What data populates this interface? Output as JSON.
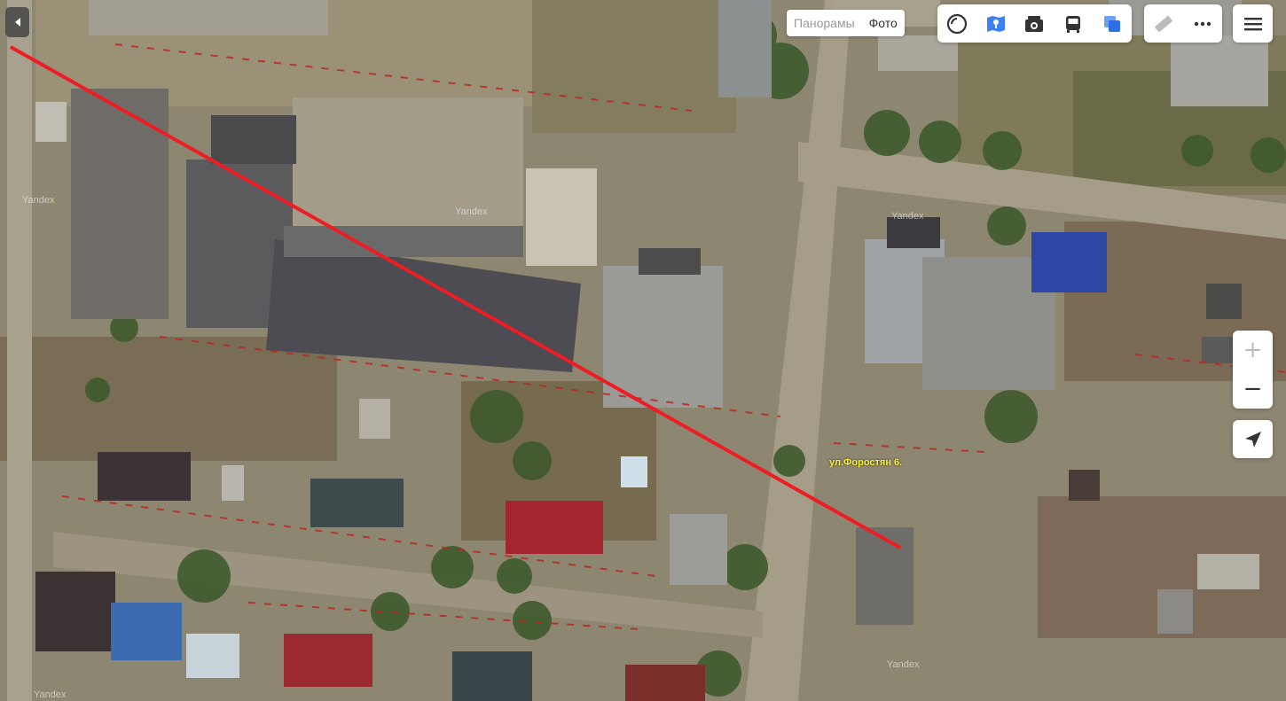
{
  "layers": {
    "panoramas_label": "Панорамы",
    "photo_label": "Фото"
  },
  "toolbar": {
    "items": [
      "traffic-icon",
      "layers-map-icon",
      "camera-icon",
      "bus-icon",
      "satellite-icon"
    ],
    "accent": "#3b82f6"
  },
  "tools": {
    "ruler": "ruler-icon",
    "more": "more-icon"
  },
  "menu": {
    "icon": "hamburger-icon"
  },
  "zoom": {
    "plus": "+",
    "minus": "−"
  },
  "map": {
    "street_label": "ул.Форостян 6.",
    "watermark": "Yandex",
    "route_color": "#ee1c24"
  }
}
